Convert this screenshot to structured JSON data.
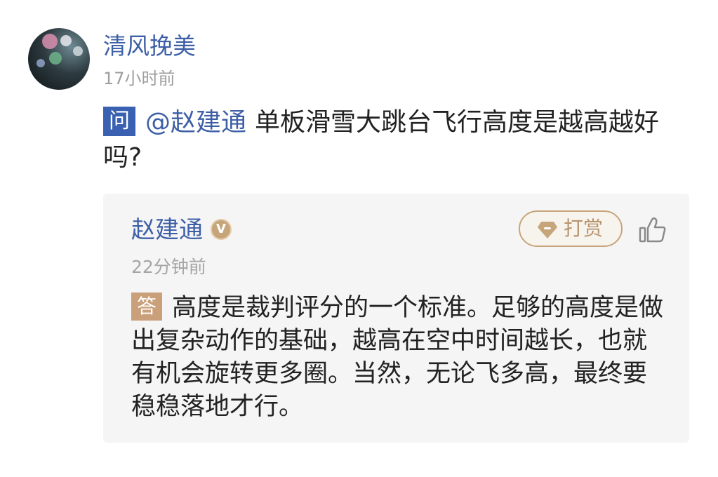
{
  "asker": {
    "name": "清风挽美",
    "time": "17小时前",
    "avatar_icon": "avatar-photo"
  },
  "question": {
    "badge": "问",
    "mention": "@赵建通",
    "text": "单板滑雪大跳台飞行高度是越高越好吗?"
  },
  "answer": {
    "author": "赵建通",
    "verified_icon": "verified-v-badge-icon",
    "verified_glyph": "V",
    "tip_label": "打赏",
    "tip_icon": "gem-icon",
    "like_icon": "thumbs-up-icon",
    "time": "22分钟前",
    "badge": "答",
    "text": "高度是裁判评分的一个标准。足够的高度是做出复杂动作的基础，越高在空中时间越长，也就有机会旋转更多圈。当然，无论飞多高，最终要稳稳落地才行。"
  },
  "colors": {
    "link_blue": "#3d5fa6",
    "question_badge": "#3a61b1",
    "gold_accent": "#c7a57a",
    "answer_badge": "#c9a07a",
    "card_bg": "#f5f5f5",
    "muted_text": "#9e9e9e"
  }
}
